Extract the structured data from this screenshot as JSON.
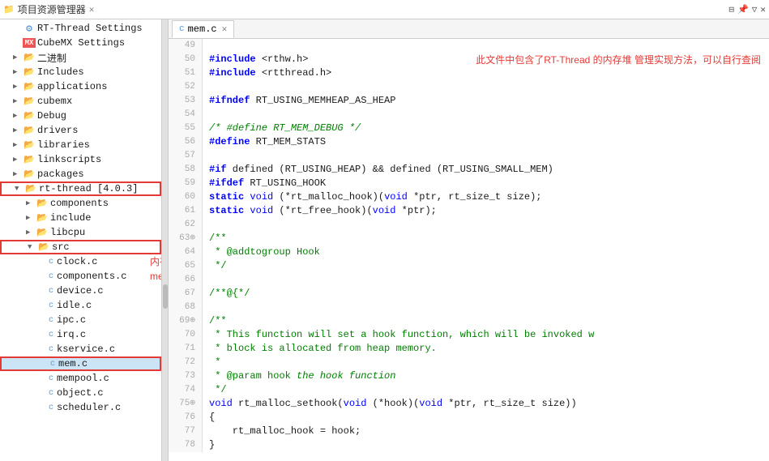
{
  "titleBar": {
    "title": "项目资源管理器",
    "closeLabel": "×",
    "icons": [
      "⊟",
      "□",
      "—",
      "×"
    ]
  },
  "leftPanel": {
    "title": "项目资源管理器",
    "items": [
      {
        "id": "rt-thread-settings",
        "label": "RT-Thread Settings",
        "indent": 1,
        "type": "settings",
        "icon": "⚙"
      },
      {
        "id": "cubemx-settings",
        "label": "CubeMX Settings",
        "indent": 1,
        "type": "cubemx",
        "icon": "MX"
      },
      {
        "id": "binary",
        "label": "二进制",
        "indent": 1,
        "type": "folder",
        "arrow": "▶"
      },
      {
        "id": "includes",
        "label": "Includes",
        "indent": 1,
        "type": "folder",
        "arrow": "▶"
      },
      {
        "id": "applications",
        "label": "applications",
        "indent": 1,
        "type": "folder",
        "arrow": "▶"
      },
      {
        "id": "cubemx",
        "label": "cubemx",
        "indent": 1,
        "type": "folder",
        "arrow": "▶"
      },
      {
        "id": "debug",
        "label": "Debug",
        "indent": 1,
        "type": "folder",
        "arrow": "▶"
      },
      {
        "id": "drivers",
        "label": "drivers",
        "indent": 1,
        "type": "folder",
        "arrow": "▶"
      },
      {
        "id": "libraries",
        "label": "libraries",
        "indent": 1,
        "type": "folder",
        "arrow": "▶"
      },
      {
        "id": "linkscripts",
        "label": "linkscripts",
        "indent": 1,
        "type": "folder",
        "arrow": "▶"
      },
      {
        "id": "packages",
        "label": "packages",
        "indent": 1,
        "type": "folder",
        "arrow": "▶"
      },
      {
        "id": "rt-thread",
        "label": "rt-thread [4.0.3]",
        "indent": 1,
        "type": "folder-open",
        "arrow": "▼",
        "highlighted": true
      },
      {
        "id": "components",
        "label": "components",
        "indent": 2,
        "type": "folder",
        "arrow": "▶"
      },
      {
        "id": "include",
        "label": "include",
        "indent": 2,
        "type": "folder",
        "arrow": "▶"
      },
      {
        "id": "libcpu",
        "label": "libcpu",
        "indent": 2,
        "type": "folder",
        "arrow": "▶"
      },
      {
        "id": "src",
        "label": "src",
        "indent": 2,
        "type": "folder-open",
        "arrow": "▼",
        "highlighted": true
      },
      {
        "id": "clock.c",
        "label": "clock.c",
        "indent": 3,
        "type": "file-c"
      },
      {
        "id": "components.c",
        "label": "components.c",
        "indent": 3,
        "type": "file-c"
      },
      {
        "id": "device.c",
        "label": "device.c",
        "indent": 3,
        "type": "file-c"
      },
      {
        "id": "idle.c",
        "label": "idle.c",
        "indent": 3,
        "type": "file-c"
      },
      {
        "id": "ipc.c",
        "label": "ipc.c",
        "indent": 3,
        "type": "file-c"
      },
      {
        "id": "irq.c",
        "label": "irq.c",
        "indent": 3,
        "type": "file-c"
      },
      {
        "id": "kservice.c",
        "label": "kservice.c",
        "indent": 3,
        "type": "file-c"
      },
      {
        "id": "mem.c",
        "label": "mem.c",
        "indent": 3,
        "type": "file-c",
        "selected": true,
        "highlighted": true
      },
      {
        "id": "mempool.c",
        "label": "mempool.c",
        "indent": 3,
        "type": "file-c"
      },
      {
        "id": "object.c",
        "label": "object.c",
        "indent": 3,
        "type": "file-c"
      },
      {
        "id": "scheduler.c",
        "label": "scheduler.c",
        "indent": 3,
        "type": "file-c"
      }
    ],
    "annotation1": "内存堆管理实现\n的文件路径",
    "annotation2": "mem.c 文件"
  },
  "editor": {
    "tab": "mem.c",
    "tabIcon": "c",
    "lines": [
      {
        "num": "49",
        "content": ""
      },
      {
        "num": "50",
        "content": "#include <rthw.h>"
      },
      {
        "num": "51",
        "content": "#include <rtthread.h>"
      },
      {
        "num": "52",
        "content": ""
      },
      {
        "num": "53",
        "content": "#ifndef RT_USING_MEMHEAP_AS_HEAP"
      },
      {
        "num": "54",
        "content": ""
      },
      {
        "num": "55",
        "content": "/* #define RT_MEM_DEBUG */"
      },
      {
        "num": "56",
        "content": "#define RT_MEM_STATS"
      },
      {
        "num": "57",
        "content": ""
      },
      {
        "num": "58",
        "content": "#if defined (RT_USING_HEAP) && defined (RT_USING_SMALL_MEM)"
      },
      {
        "num": "59",
        "content": "#ifdef RT_USING_HOOK"
      },
      {
        "num": "60",
        "content": "static void (*rt_malloc_hook)(void *ptr, rt_size_t size);"
      },
      {
        "num": "61",
        "content": "static void (*rt_free_hook)(void *ptr);"
      },
      {
        "num": "62",
        "content": ""
      },
      {
        "num": "63",
        "content": "/**",
        "fold": true
      },
      {
        "num": "64",
        "content": " * @addtogroup Hook"
      },
      {
        "num": "65",
        "content": " */"
      },
      {
        "num": "66",
        "content": ""
      },
      {
        "num": "67",
        "content": "/**@{*/"
      },
      {
        "num": "68",
        "content": ""
      },
      {
        "num": "69",
        "content": "/**",
        "fold": true
      },
      {
        "num": "70",
        "content": " * This function will set a hook function, which will be invoked w"
      },
      {
        "num": "71",
        "content": " * block is allocated from heap memory."
      },
      {
        "num": "72",
        "content": " *"
      },
      {
        "num": "73",
        "content": " * @param hook the hook function"
      },
      {
        "num": "74",
        "content": " */"
      },
      {
        "num": "75",
        "content": "void rt_malloc_sethook(void (*hook)(void *ptr, rt_size_t size))"
      },
      {
        "num": "76",
        "content": "{"
      },
      {
        "num": "77",
        "content": "    rt_malloc_hook = hook;"
      },
      {
        "num": "78",
        "content": "}"
      }
    ],
    "annotation": "此文件中包含了RT-Thread 的内存堆\n管理实现方法，可以自行查阅"
  }
}
